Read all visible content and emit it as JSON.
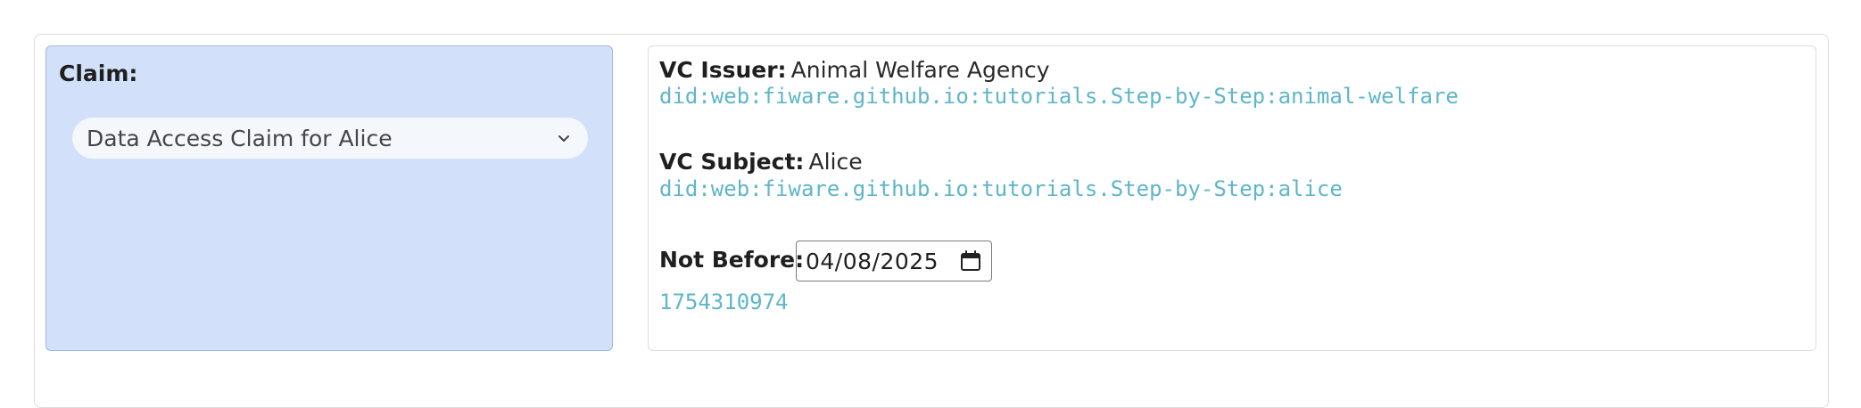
{
  "claim": {
    "label": "Claim:",
    "selected": "Data Access Claim for Alice"
  },
  "vc": {
    "issuer_label": "VC Issuer:",
    "issuer_name": "Animal Welfare Agency",
    "issuer_did": "did:web:fiware.github.io:tutorials.Step-by-Step:animal-welfare",
    "subject_label": "VC Subject:",
    "subject_name": "Alice",
    "subject_did": "did:web:fiware.github.io:tutorials.Step-by-Step:alice",
    "not_before_label": "Not Before:",
    "not_before_date": "04/08/2025",
    "not_before_timestamp": "1754310974"
  },
  "icons": {
    "dropdown": "chevron-down-icon",
    "date": "calendar-icon"
  },
  "colors": {
    "claim_panel_bg": "#d3e0fa",
    "did_text": "#5fb6c8"
  }
}
